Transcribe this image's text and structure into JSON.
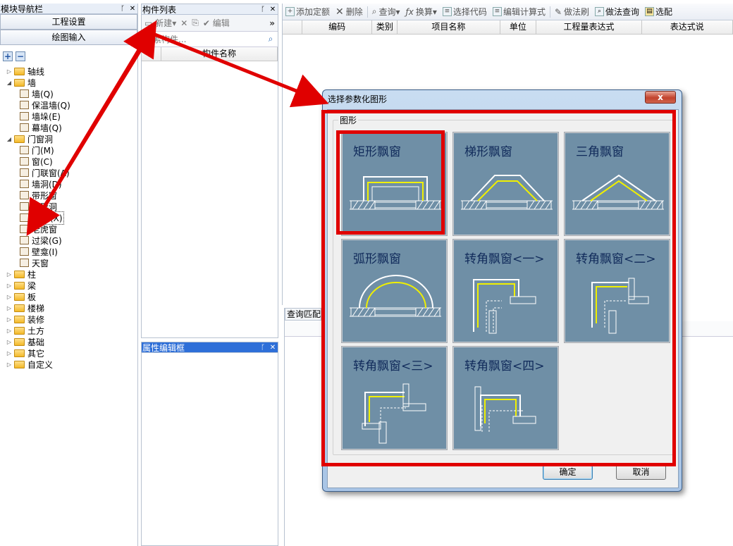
{
  "nav": {
    "title": "模块导航栏",
    "btn_settings": "工程设置",
    "btn_drawing": "绘图输入",
    "add": "+",
    "remove": "−",
    "tree": [
      {
        "label": "轴线",
        "expanded": false,
        "level": 0
      },
      {
        "label": "墙",
        "expanded": true,
        "level": 0
      },
      {
        "label": "墙(Q)",
        "level": 1
      },
      {
        "label": "保温墙(Q)",
        "level": 1
      },
      {
        "label": "墙垛(E)",
        "level": 1
      },
      {
        "label": "幕墙(Q)",
        "level": 1
      },
      {
        "label": "门窗洞",
        "expanded": true,
        "level": 0
      },
      {
        "label": "门(M)",
        "level": 1
      },
      {
        "label": "窗(C)",
        "level": 1
      },
      {
        "label": "门联窗(A)",
        "level": 1
      },
      {
        "label": "墙洞(D)",
        "level": 1
      },
      {
        "label": "带形窗",
        "level": 1
      },
      {
        "label": "带形洞",
        "level": 1
      },
      {
        "label": "飘窗(X)",
        "level": 1,
        "selected": true
      },
      {
        "label": "老虎窗",
        "level": 1
      },
      {
        "label": "过梁(G)",
        "level": 1
      },
      {
        "label": "壁龛(I)",
        "level": 1
      },
      {
        "label": "天窗",
        "level": 1
      },
      {
        "label": "柱",
        "expanded": false,
        "level": 0
      },
      {
        "label": "梁",
        "expanded": false,
        "level": 0
      },
      {
        "label": "板",
        "expanded": false,
        "level": 0
      },
      {
        "label": "楼梯",
        "expanded": false,
        "level": 0
      },
      {
        "label": "装修",
        "expanded": false,
        "level": 0
      },
      {
        "label": "土方",
        "expanded": false,
        "level": 0
      },
      {
        "label": "基础",
        "expanded": false,
        "level": 0
      },
      {
        "label": "其它",
        "expanded": false,
        "level": 0
      },
      {
        "label": "自定义",
        "expanded": false,
        "level": 0
      }
    ]
  },
  "comp": {
    "title": "构件列表",
    "new": "新建",
    "edit": "编辑",
    "search_placeholder": "搜索构件...",
    "col_name": "构件名称",
    "more": "»"
  },
  "prop": {
    "title": "属性编辑框"
  },
  "toolbar": {
    "add_quota": "添加定额",
    "delete": "删除",
    "query": "查询",
    "convert": "换算",
    "select_code": "选择代码",
    "edit_formula": "编辑计算式",
    "method_brush": "做法刷",
    "method_query": "做法查询",
    "select_match": "选配"
  },
  "grid": {
    "cols": [
      "编码",
      "类别",
      "项目名称",
      "单位",
      "工程量表达式",
      "表达式说"
    ]
  },
  "query_panel": {
    "title": "查询匹配"
  },
  "dialog": {
    "title": "选择参数化图形",
    "group": "图形",
    "close": "x",
    "ok": "确定",
    "cancel": "取消",
    "shapes": [
      "矩形飘窗",
      "梯形飘窗",
      "三角飘窗",
      "弧形飘窗",
      "转角飘窗<一>",
      "转角飘窗<二>",
      "转角飘窗<三>",
      "转角飘窗<四>"
    ],
    "selected": "矩形飘窗"
  },
  "colors": {
    "annotation": "#e00000",
    "tile": "#6f8fa6",
    "tile_text": "#102a5a",
    "highlight": "#f0f000"
  }
}
